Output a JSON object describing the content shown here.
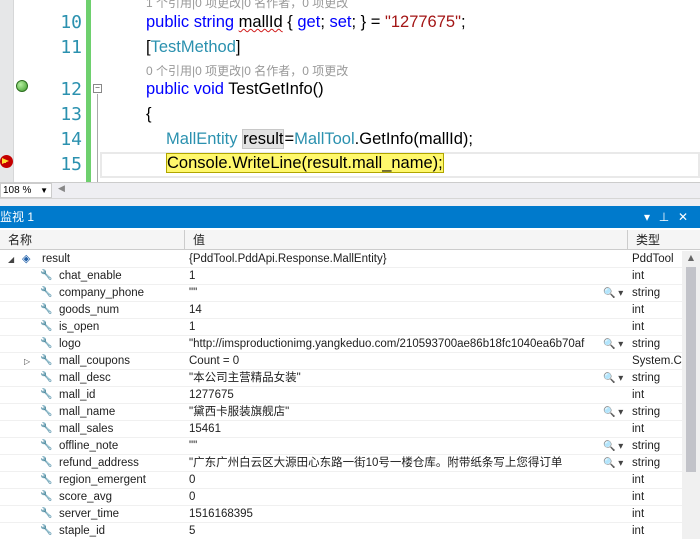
{
  "editor": {
    "zoom": "108 %",
    "lens_top": "1 个引用|0 项更改|0 名作者，0 项更改",
    "lens_mid": "0 个引用|0 项更改|0 名作者，0 项更改",
    "lines": [
      {
        "no": "10",
        "kw1": "public",
        "kw2": "string",
        "ident": "mallId",
        "rest1": " { ",
        "get": "get",
        "semi1": "; ",
        "set": "set",
        "rest2": "; } = ",
        "str": "\"1277675\"",
        "end": ";"
      },
      {
        "no": "11",
        "attr_open": "[",
        "attr": "TestMethod",
        "attr_close": "]"
      },
      {
        "no": "12",
        "kw1": "public",
        "kw2": "void",
        "rest": " TestGetInfo()"
      },
      {
        "no": "13",
        "text": "{"
      },
      {
        "no": "14",
        "type1": "MallEntity",
        "var": "result",
        "eq": "=",
        "type2": "MallTool",
        "rest": ".GetInfo(mallId);"
      },
      {
        "no": "15",
        "stmt": "Console.WriteLine(result.mall_name);"
      }
    ]
  },
  "watch": {
    "title": "监视 1",
    "btn_dropdown": "▾",
    "btn_pin": "⊥",
    "btn_close": "✕",
    "headers": {
      "name": "名称",
      "value": "值",
      "type": "类型"
    },
    "root": {
      "name": "result",
      "value": "{PddTool.PddApi.Response.MallEntity}",
      "type": "PddTool"
    },
    "rows": [
      {
        "name": "chat_enable",
        "value": "1",
        "type": "int",
        "mag": false
      },
      {
        "name": "company_phone",
        "value": "\"\"",
        "type": "string",
        "mag": true
      },
      {
        "name": "goods_num",
        "value": "14",
        "type": "int",
        "mag": false
      },
      {
        "name": "is_open",
        "value": "1",
        "type": "int",
        "mag": false
      },
      {
        "name": "logo",
        "value": "\"http://imsproductionimg.yangkeduo.com/210593700ae86b18fc1040ea6b70af",
        "type": "string",
        "mag": true
      },
      {
        "name": "mall_coupons",
        "value": "Count = 0",
        "type": "System.C",
        "mag": false,
        "expand": true
      },
      {
        "name": "mall_desc",
        "value": "\"本公司主营精品女装\"",
        "type": "string",
        "mag": true
      },
      {
        "name": "mall_id",
        "value": "1277675",
        "type": "int",
        "mag": false
      },
      {
        "name": "mall_name",
        "value": "\"黛西卡服装旗舰店\"",
        "type": "string",
        "mag": true
      },
      {
        "name": "mall_sales",
        "value": "15461",
        "type": "int",
        "mag": false
      },
      {
        "name": "offline_note",
        "value": "\"\"",
        "type": "string",
        "mag": true
      },
      {
        "name": "refund_address",
        "value": "\"广东广州白云区大源田心东路一街10号一楼仓库。附带纸条写上您得订单",
        "type": "string",
        "mag": true
      },
      {
        "name": "region_emergent",
        "value": "0",
        "type": "int",
        "mag": false
      },
      {
        "name": "score_avg",
        "value": "0",
        "type": "int",
        "mag": false
      },
      {
        "name": "server_time",
        "value": "1516168395",
        "type": "int",
        "mag": false
      },
      {
        "name": "staple_id",
        "value": "5",
        "type": "int",
        "mag": false
      }
    ]
  }
}
